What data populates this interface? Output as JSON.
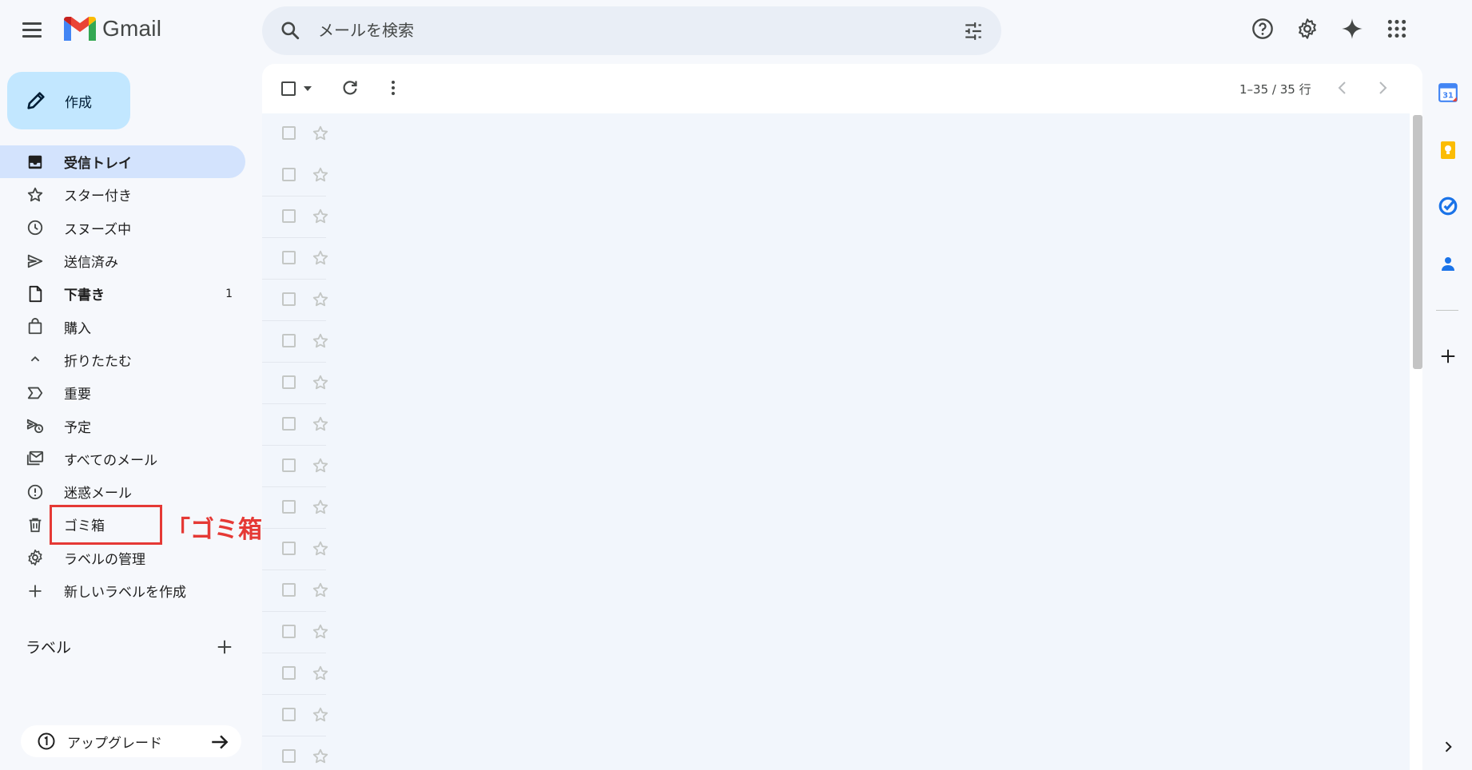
{
  "app": {
    "name": "Gmail"
  },
  "search": {
    "placeholder": "メールを検索"
  },
  "compose": {
    "label": "作成"
  },
  "nav": {
    "items": [
      {
        "label": "受信トレイ",
        "icon": "inbox-icon"
      },
      {
        "label": "スター付き",
        "icon": "star-icon"
      },
      {
        "label": "スヌーズ中",
        "icon": "clock-icon"
      },
      {
        "label": "送信済み",
        "icon": "send-icon"
      },
      {
        "label": "下書き",
        "icon": "draft-icon",
        "count": "1"
      },
      {
        "label": "購入",
        "icon": "shopping-bag-icon"
      },
      {
        "label": "折りたたむ",
        "icon": "chevron-up-icon"
      },
      {
        "label": "重要",
        "icon": "important-icon"
      },
      {
        "label": "予定",
        "icon": "scheduled-icon"
      },
      {
        "label": "すべてのメール",
        "icon": "all-mail-icon"
      },
      {
        "label": "迷惑メール",
        "icon": "spam-icon"
      },
      {
        "label": "ゴミ箱",
        "icon": "trash-icon"
      },
      {
        "label": "ラベルの管理",
        "icon": "gear-icon"
      },
      {
        "label": "新しいラベルを作成",
        "icon": "plus-icon"
      }
    ]
  },
  "labels": {
    "title": "ラベル"
  },
  "upgrade": {
    "label": "アップグレード"
  },
  "annotation": {
    "text": "「ゴミ箱」をクリックして確認します",
    "color": "#e53935"
  },
  "toolbar": {
    "pager": "1–35 / 35 行"
  },
  "list": {
    "row_count": 16
  },
  "colors": {
    "accent": "#c2e7ff",
    "active_nav": "#d3e3fd",
    "background": "#f6f8fc"
  }
}
